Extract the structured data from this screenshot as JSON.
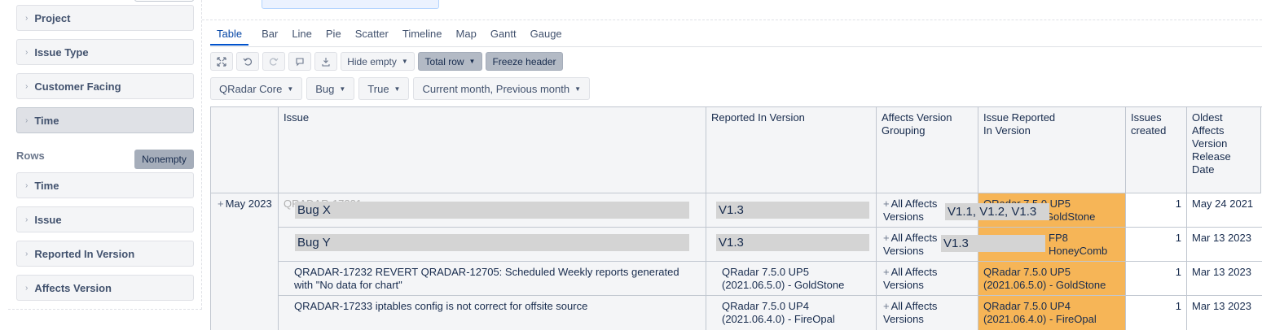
{
  "sidebar": {
    "columns_items": [
      "Project",
      "Issue Type",
      "Customer Facing",
      "Time"
    ],
    "rows_label": "Rows",
    "nonempty_label": "Nonempty",
    "rows_items": [
      "Time",
      "Issue",
      "Reported In Version",
      "Affects Version"
    ]
  },
  "tabs": [
    "Table",
    "Bar",
    "Line",
    "Pie",
    "Scatter",
    "Timeline",
    "Map",
    "Gantt",
    "Gauge"
  ],
  "toolbar": {
    "hide_empty": "Hide empty",
    "total_row": "Total row",
    "freeze_header": "Freeze header"
  },
  "filters": [
    "QRadar Core",
    "Bug",
    "True",
    "Current month, Previous month"
  ],
  "table": {
    "headers": {
      "issue": "Issue",
      "reported_in_version": "Reported In Version",
      "affects_version_grouping": "Affects Version Grouping",
      "issue_reported_in_version": "Issue Reported In Version",
      "issues_created": "Issues created",
      "oldest_affects": "Oldest Affects Version Release Date"
    },
    "row_group": "May 2023",
    "rows": [
      {
        "issue": "Bug X",
        "reported": "V1.3",
        "affects": "All Affects Versions",
        "affects_overlay": "V1.1, V1.2, V1.3",
        "issue_reported_line1": "QRadar 7.5.0 UP5",
        "issue_reported_line2": "- GoldStone",
        "created": "1",
        "oldest": "May 24 2021"
      },
      {
        "issue": "Bug Y",
        "reported": "V1.3",
        "affects": "All Affects Versions",
        "affects_overlay": "V1.3",
        "issue_reported_line1": "FP8",
        "issue_reported_line2": "HoneyComb",
        "created": "1",
        "oldest": "Mar 13 2023"
      },
      {
        "issue": "QRADAR-17232 REVERT QRADAR-12705: Scheduled Weekly reports generated with \"No data for chart\"",
        "reported": "QRadar 7.5.0 UP5 (2021.06.5.0) - GoldStone",
        "affects": "All Affects Versions",
        "issue_reported": "QRadar 7.5.0 UP5 (2021.06.5.0) - GoldStone",
        "created": "1",
        "oldest": "Mar 13 2023"
      },
      {
        "issue": "QRADAR-17233 iptables config is not correct for offsite source",
        "reported": "QRadar 7.5.0 UP4 (2021.06.4.0) - FireOpal",
        "affects": "All Affects Versions",
        "issue_reported": "QRadar 7.5.0 UP4 (2021.06.4.0) - FireOpal",
        "created": "1",
        "oldest": "Mar 13 2023"
      }
    ]
  }
}
